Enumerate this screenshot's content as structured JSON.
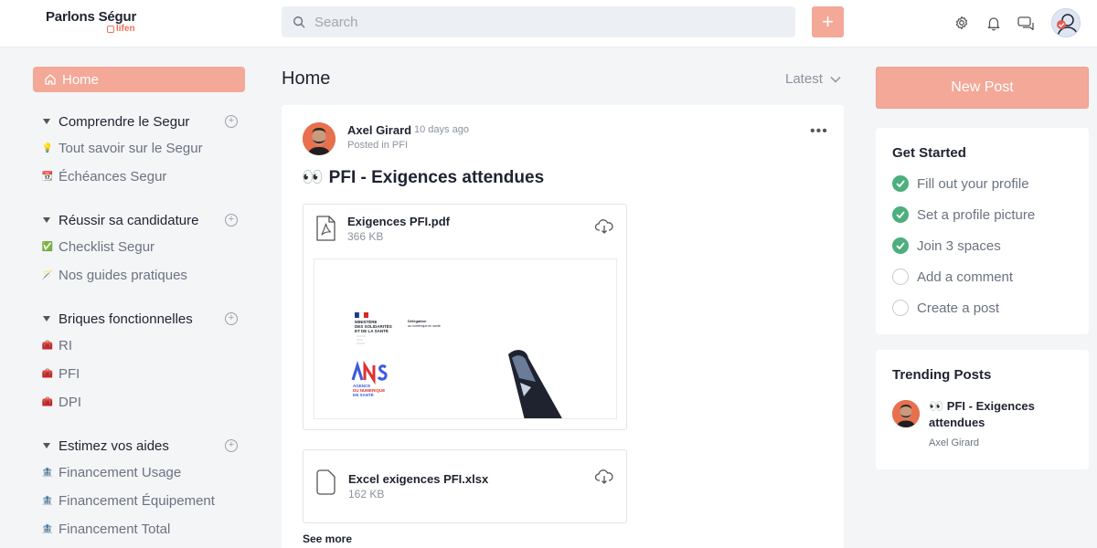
{
  "header": {
    "brand": "Parlons Ségur",
    "brand_sub": "lifen",
    "search_placeholder": "Search",
    "new_button": "+"
  },
  "sidebar": {
    "home": "Home",
    "sections": [
      {
        "title": "Comprendre le Segur",
        "items": [
          {
            "emoji": "💡",
            "label": "Tout savoir sur le Segur"
          },
          {
            "emoji": "📆",
            "label": "Échéances Segur"
          }
        ]
      },
      {
        "title": "Réussir sa candidature",
        "items": [
          {
            "emoji": "✅",
            "label": "Checklist Segur"
          },
          {
            "emoji": "🪄",
            "label": "Nos guides pratiques"
          }
        ]
      },
      {
        "title": "Briques fonctionnelles",
        "items": [
          {
            "emoji": "🧰",
            "label": "RI"
          },
          {
            "emoji": "🧰",
            "label": "PFI"
          },
          {
            "emoji": "🧰",
            "label": "DPI"
          }
        ]
      },
      {
        "title": "Estimez vos aides",
        "items": [
          {
            "emoji": "🏦",
            "label": "Financement Usage"
          },
          {
            "emoji": "🏦",
            "label": "Financement Équipement"
          },
          {
            "emoji": "🏦",
            "label": "Financement Total"
          }
        ]
      }
    ]
  },
  "main": {
    "title": "Home",
    "sort": "Latest",
    "post": {
      "author": "Axel Girard",
      "time": "10 days ago",
      "posted_in": "Posted in PFI",
      "title": "PFI - Exigences attendues",
      "title_emoji": "👀",
      "attachments": [
        {
          "name": "Exigences PFI.pdf",
          "size": "366 KB"
        },
        {
          "name": "Excel exigences PFI.xlsx",
          "size": "162 KB"
        }
      ],
      "preview": {
        "ministry": "MINISTÈRE DES SOLIDARITÉS ET DE LA SANTÉ",
        "delegation": "Délégation au numérique en santé",
        "ans": "AGENCE DU NUMÉRIQUE EN SANTÉ"
      },
      "see_more": "See more"
    }
  },
  "right": {
    "new_post": "New Post",
    "get_started": {
      "title": "Get Started",
      "tasks": [
        {
          "label": "Fill out your profile",
          "done": true
        },
        {
          "label": "Set a profile picture",
          "done": true
        },
        {
          "label": "Join 3 spaces",
          "done": true
        },
        {
          "label": "Add a comment",
          "done": false
        },
        {
          "label": "Create a post",
          "done": false
        }
      ]
    },
    "trending": {
      "title": "Trending Posts",
      "post_title": "👀 PFI - Exigences attendues",
      "post_author": "Axel Girard"
    }
  },
  "colors": {
    "accent": "#f4a898",
    "success": "#4caf7d",
    "brand": "#f0705a"
  }
}
